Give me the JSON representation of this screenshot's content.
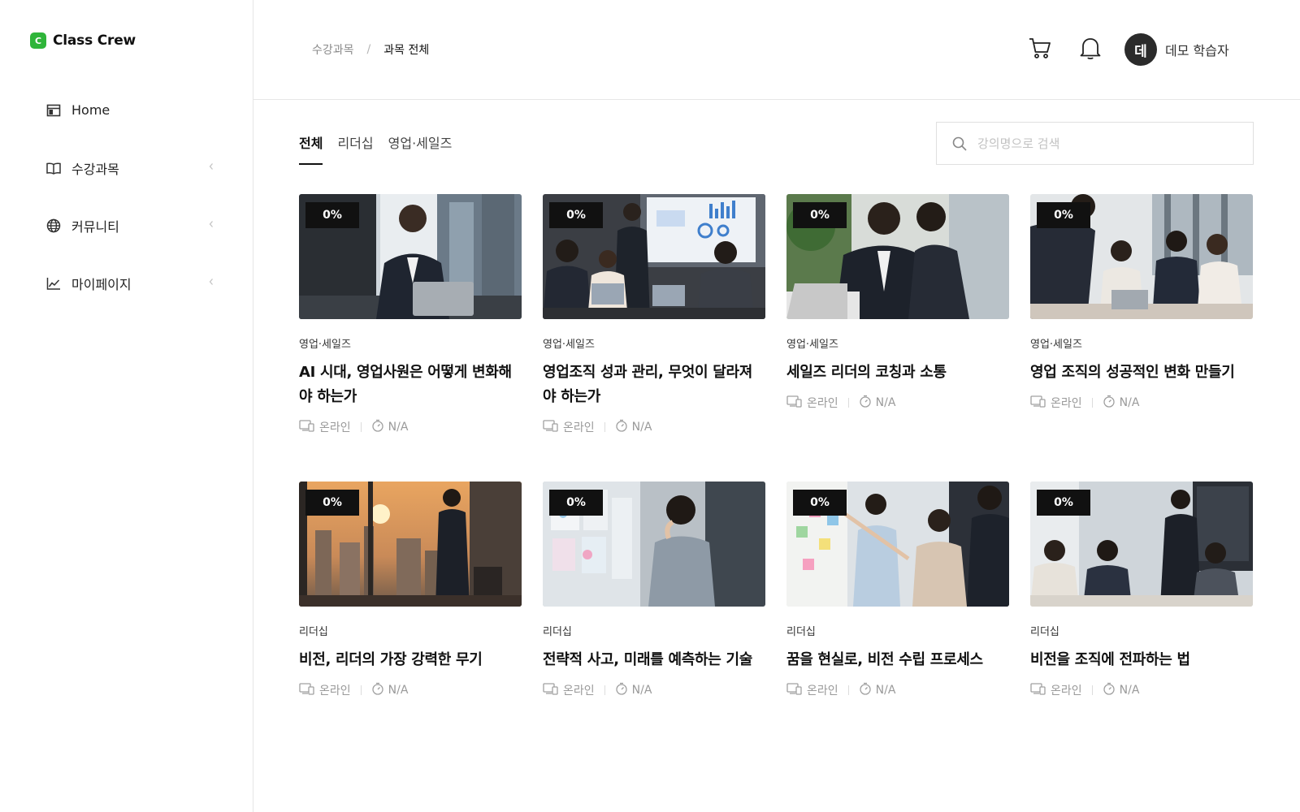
{
  "brand": {
    "logo_letter": "C",
    "name": "Class Crew"
  },
  "sidebar": {
    "items": [
      {
        "label": "Home",
        "icon": "home-layout-icon",
        "has_chevron": false
      },
      {
        "label": "수강과목",
        "icon": "book-icon",
        "has_chevron": true
      },
      {
        "label": "커뮤니티",
        "icon": "globe-icon",
        "has_chevron": true
      },
      {
        "label": "마이페이지",
        "icon": "chart-line-icon",
        "has_chevron": true
      }
    ]
  },
  "header": {
    "breadcrumb": {
      "parent": "수강과목",
      "separator": "/",
      "current": "과목 전체"
    },
    "user": {
      "initial": "데",
      "name": "데모 학습자"
    }
  },
  "tabs": [
    {
      "label": "전체",
      "active": true
    },
    {
      "label": "리더십",
      "active": false
    },
    {
      "label": "영업·세일즈",
      "active": false
    }
  ],
  "search": {
    "placeholder": "강의명으로 검색",
    "value": ""
  },
  "courses": [
    {
      "progress": "0%",
      "category": "영업·세일즈",
      "title": "AI 시대, 영업사원은 어떻게 변화해야 하는가",
      "mode": "온라인",
      "duration": "N/A"
    },
    {
      "progress": "0%",
      "category": "영업·세일즈",
      "title": "영업조직 성과 관리, 무엇이 달라져야 하는가",
      "mode": "온라인",
      "duration": "N/A"
    },
    {
      "progress": "0%",
      "category": "영업·세일즈",
      "title": "세일즈 리더의 코칭과 소통",
      "mode": "온라인",
      "duration": "N/A"
    },
    {
      "progress": "0%",
      "category": "영업·세일즈",
      "title": "영업 조직의 성공적인 변화 만들기",
      "mode": "온라인",
      "duration": "N/A"
    },
    {
      "progress": "0%",
      "category": "리더십",
      "title": "비전, 리더의 가장 강력한 무기",
      "mode": "온라인",
      "duration": "N/A"
    },
    {
      "progress": "0%",
      "category": "리더십",
      "title": "전략적 사고, 미래를 예측하는 기술",
      "mode": "온라인",
      "duration": "N/A"
    },
    {
      "progress": "0%",
      "category": "리더십",
      "title": "꿈을 현실로, 비전 수립 프로세스",
      "mode": "온라인",
      "duration": "N/A"
    },
    {
      "progress": "0%",
      "category": "리더십",
      "title": "비전을 조직에 전파하는 법",
      "mode": "온라인",
      "duration": "N/A"
    }
  ],
  "colors": {
    "brand_green": "#2fb53a",
    "badge_bg": "#111111",
    "avatar_bg": "#2b2b2b",
    "border": "#e6e6e6"
  }
}
